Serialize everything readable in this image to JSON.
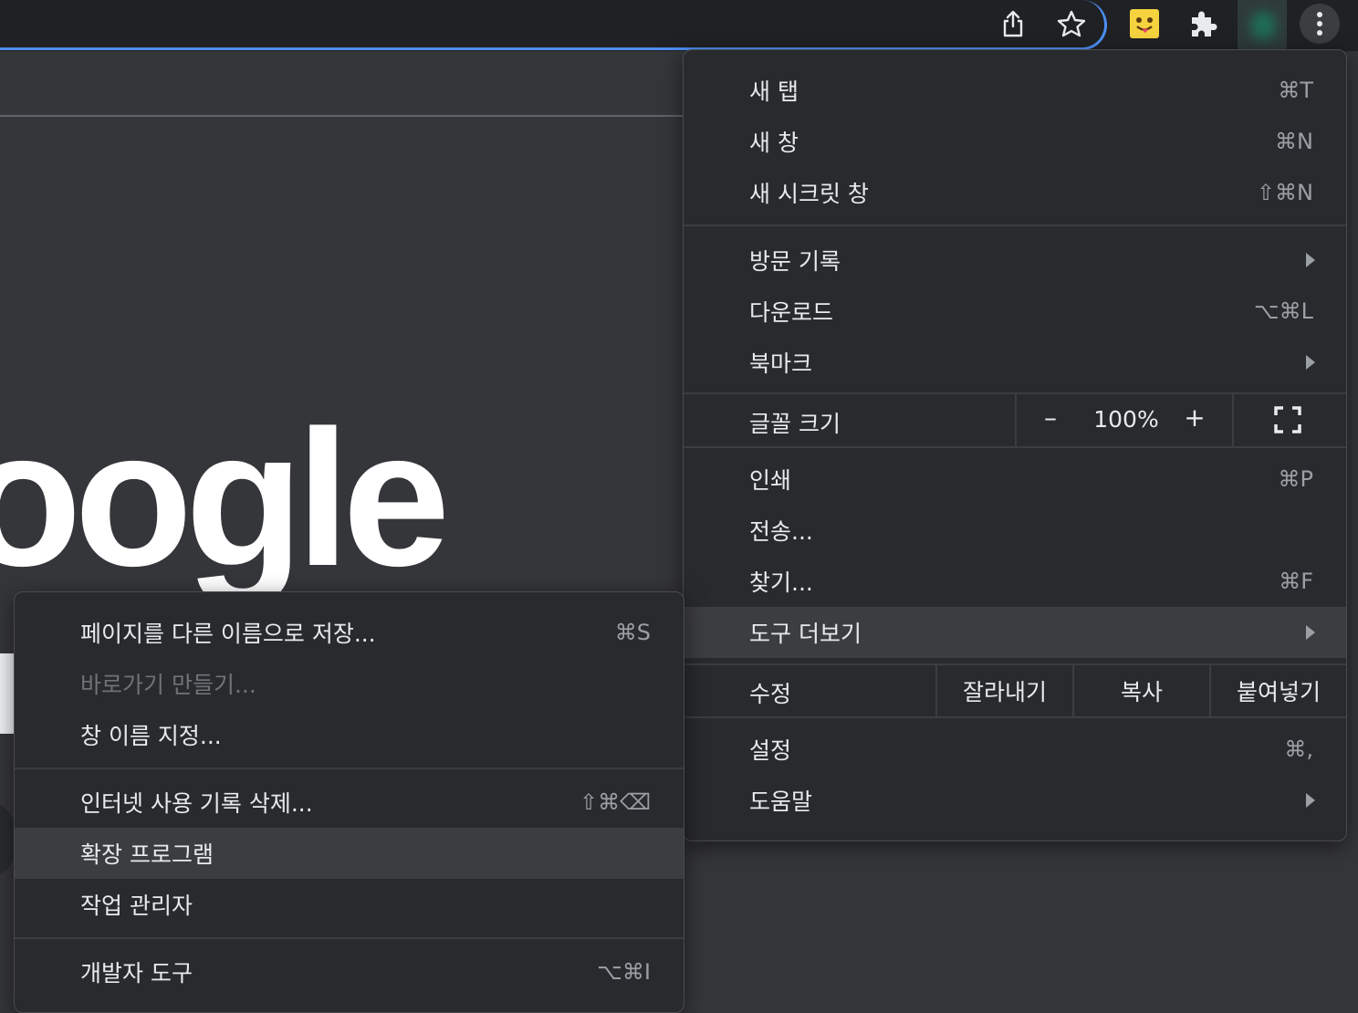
{
  "toolbar": {
    "icons": [
      "share-icon",
      "star-icon",
      "extension-emoji-icon",
      "puzzle-icon",
      "profile-avatar",
      "more-menu-icon"
    ]
  },
  "page": {
    "logo_text": "oogle"
  },
  "main_menu": {
    "new_tab": {
      "label": "새 탭",
      "shortcut": "⌘T"
    },
    "new_window": {
      "label": "새 창",
      "shortcut": "⌘N"
    },
    "new_incognito": {
      "label": "새 시크릿 창",
      "shortcut": "⇧⌘N"
    },
    "history": {
      "label": "방문 기록"
    },
    "downloads": {
      "label": "다운로드",
      "shortcut": "⌥⌘L"
    },
    "bookmarks": {
      "label": "북마크"
    },
    "zoom": {
      "label": "글꼴 크기",
      "minus": "–",
      "value": "100%",
      "plus": "+"
    },
    "print": {
      "label": "인쇄",
      "shortcut": "⌘P"
    },
    "cast": {
      "label": "전송..."
    },
    "find": {
      "label": "찾기...",
      "shortcut": "⌘F"
    },
    "more_tools": {
      "label": "도구 더보기"
    },
    "edit": {
      "label": "수정",
      "cut": "잘라내기",
      "copy": "복사",
      "paste": "붙여넣기"
    },
    "settings": {
      "label": "설정",
      "shortcut": "⌘,"
    },
    "help": {
      "label": "도움말"
    }
  },
  "sub_menu": {
    "save_page": {
      "label": "페이지를 다른 이름으로 저장...",
      "shortcut": "⌘S"
    },
    "create_shortcut": {
      "label": "바로가기 만들기..."
    },
    "name_window": {
      "label": "창 이름 지정..."
    },
    "clear_data": {
      "label": "인터넷 사용 기록 삭제...",
      "shortcut": "⇧⌘⌫"
    },
    "extensions": {
      "label": "확장 프로그램"
    },
    "task_manager": {
      "label": "작업 관리자"
    },
    "dev_tools": {
      "label": "개발자 도구",
      "shortcut": "⌥⌘I"
    }
  },
  "colors": {
    "accent": "#4d8ff6",
    "menu_bg": "#292a2d",
    "highlight": "#3c3d41"
  }
}
